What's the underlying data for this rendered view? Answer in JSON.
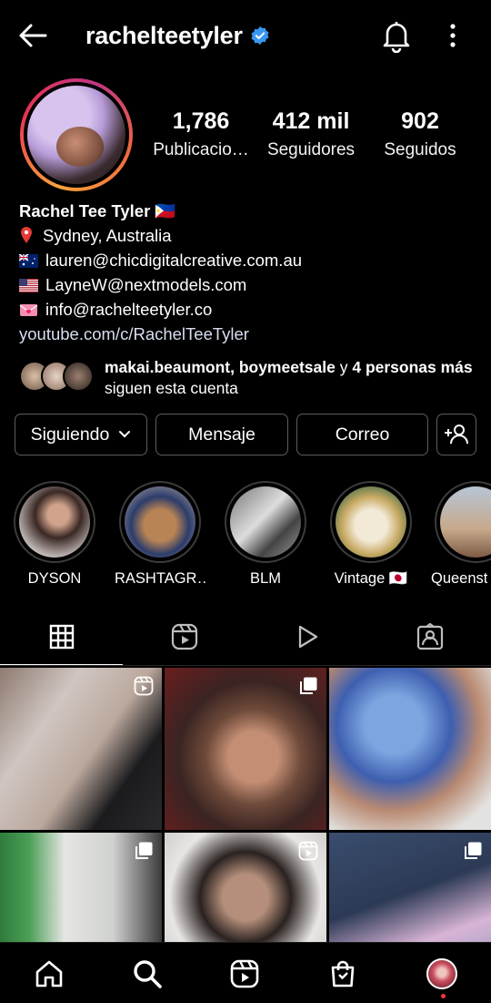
{
  "header": {
    "username": "rachelteetyler"
  },
  "stats": [
    {
      "value": "1,786",
      "label": "Publicacio…"
    },
    {
      "value": "412 mil",
      "label": "Seguidores"
    },
    {
      "value": "902",
      "label": "Seguidos"
    }
  ],
  "bio": {
    "name": "Rachel Tee Tyler 🇵🇭",
    "location": "Sydney, Australia",
    "email_au": "lauren@chicdigitalcreative.com.au",
    "email_us": "LayneW@nextmodels.com",
    "email_info": "info@rachelteetyler.co",
    "link": "youtube.com/c/RachelTeeTyler"
  },
  "followed_by": {
    "users": "makai.beaumont, boymeetsale",
    "connector": " y ",
    "others": "4 personas más",
    "suffix": " siguen esta cuenta"
  },
  "actions": {
    "following": "Siguiendo",
    "message": "Mensaje",
    "email": "Correo"
  },
  "highlights": [
    {
      "label": "DYSON"
    },
    {
      "label": "RASHTAGR…"
    },
    {
      "label": "BLM"
    },
    {
      "label": "Vintage 🇯🇵"
    },
    {
      "label": "Queenst"
    }
  ],
  "tabs": [
    "grid-icon",
    "reels-icon",
    "video-play-icon",
    "tagged-icon"
  ],
  "colors": {
    "verified": "#3897f0",
    "notification_dot": "#ff3040",
    "button_border": "#5d5d5d"
  }
}
